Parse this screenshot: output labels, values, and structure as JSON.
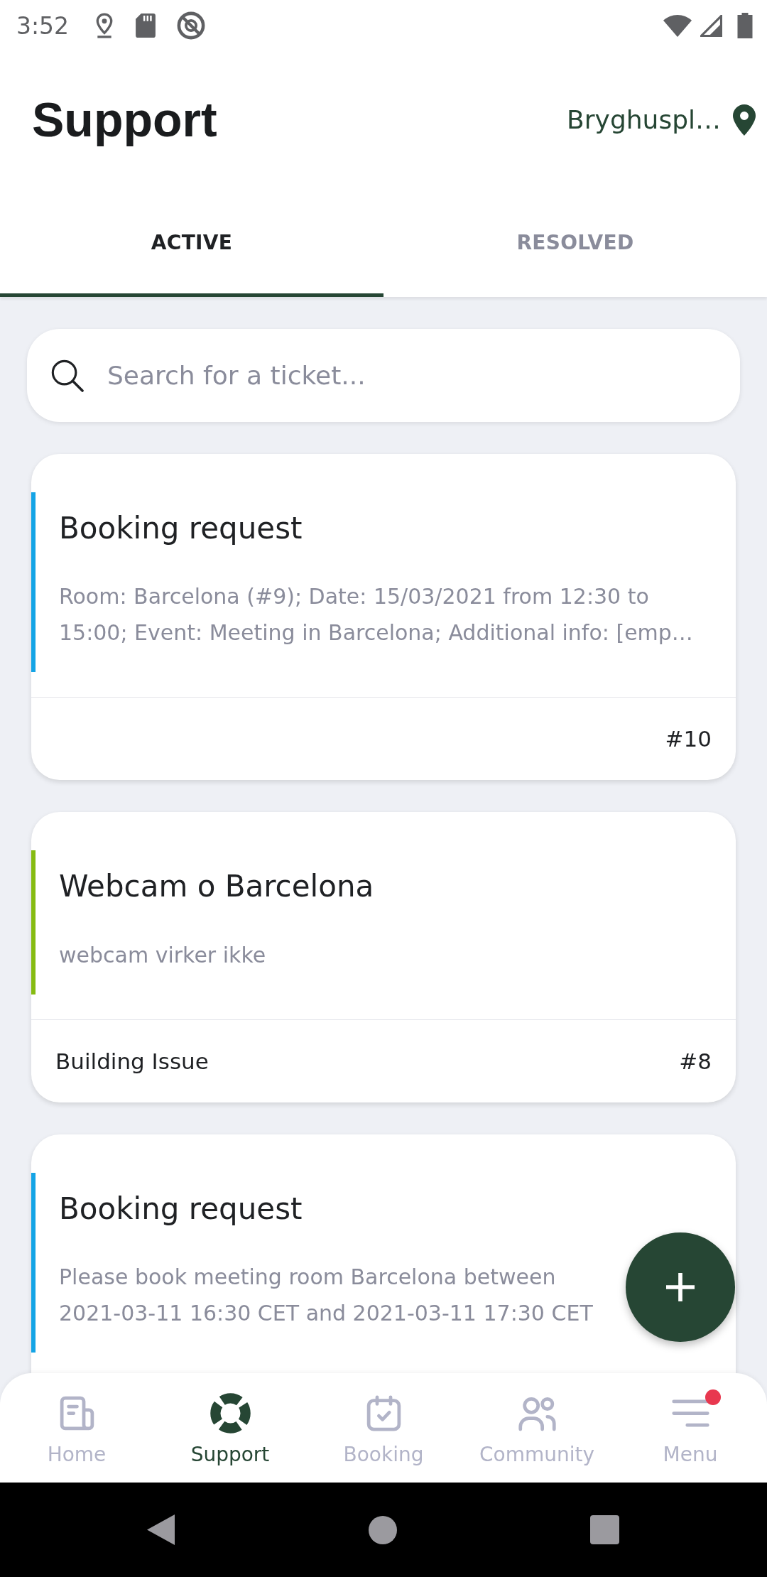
{
  "status_bar": {
    "time": "3:52"
  },
  "header": {
    "title": "Support",
    "location": "Bryghuspl…"
  },
  "tabs": [
    {
      "label": "ACTIVE",
      "selected": true
    },
    {
      "label": "RESOLVED",
      "selected": false
    }
  ],
  "search": {
    "placeholder": "Search for a ticket..."
  },
  "tickets": [
    {
      "title": "Booking request",
      "description": "Room: Barcelona (#9); Date: 15/03/2021 from 12:30 to 15:00; Event: Meeting in Barcelona; Additional info: [emp…",
      "number": "#10",
      "color": "#14a4e6"
    },
    {
      "title": "Webcam o Barcelona",
      "description": "webcam virker ikke",
      "category": "Building Issue",
      "number": "#8",
      "color": "#86bb12"
    },
    {
      "title": "Booking request",
      "description": "Please book meeting room Barcelona between 2021-03-11 16:30 CET and 2021-03-11 17:30 CET",
      "color": "#14a4e6"
    }
  ],
  "bottom_nav": [
    {
      "label": "Home",
      "selected": false,
      "notification": false
    },
    {
      "label": "Support",
      "selected": true,
      "notification": false
    },
    {
      "label": "Booking",
      "selected": false,
      "notification": false
    },
    {
      "label": "Community",
      "selected": false,
      "notification": false
    },
    {
      "label": "Menu",
      "selected": false,
      "notification": true
    }
  ]
}
